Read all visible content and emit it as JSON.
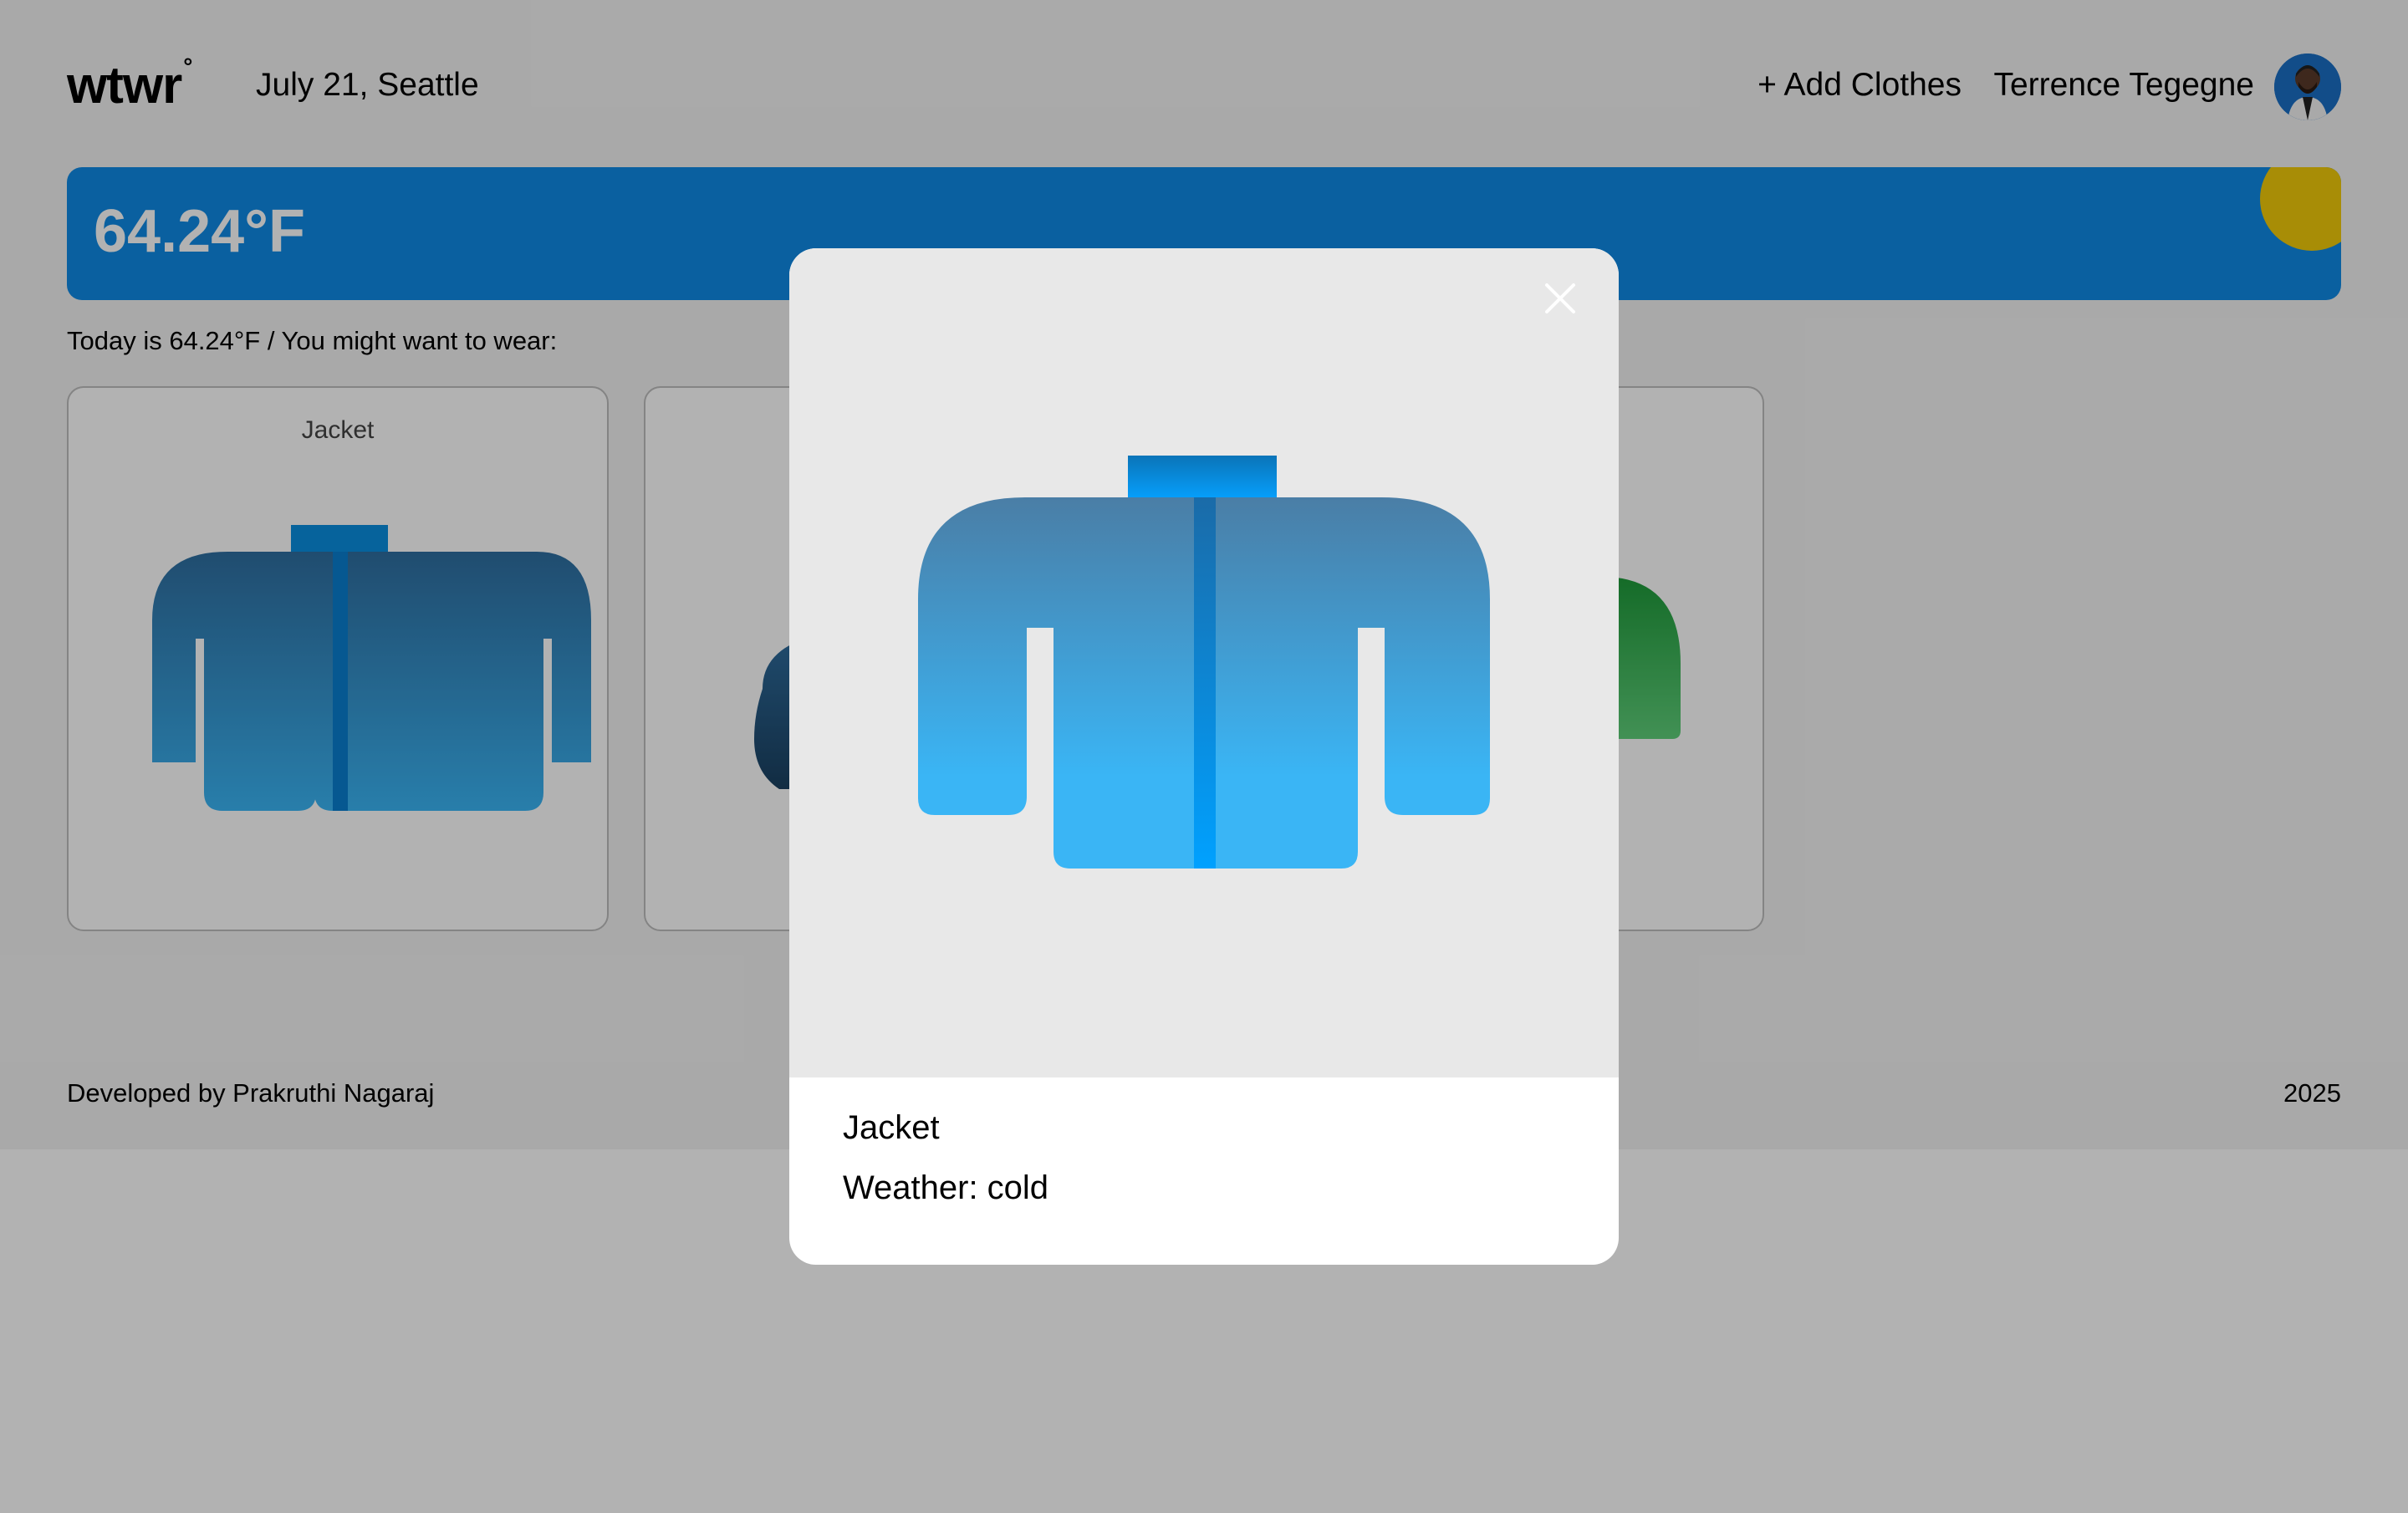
{
  "header": {
    "logo_text": "wtwr",
    "logo_degree": "°",
    "date_location": "July 21, Seattle",
    "add_clothes_label": "+ Add Clothes",
    "username": "Terrence Tegegne"
  },
  "weather": {
    "temperature": "64.24°F",
    "card_color": "#0f8ae6",
    "sun_color": "#f1cb09"
  },
  "main": {
    "today_text": "Today is 64.24°F / You might want to wear:",
    "cards": [
      {
        "name": "Jacket",
        "icon": "jacket-icon"
      },
      {
        "name": "",
        "icon": "cap-icon"
      },
      {
        "name": "",
        "icon": "jacket-icon"
      },
      {
        "name": "",
        "icon": "hoodie-icon"
      }
    ]
  },
  "footer": {
    "developer": "Developed by Prakruthi Nagaraj",
    "year": "2025"
  },
  "modal": {
    "item_name": "Jacket",
    "weather_label": "Weather: cold",
    "close_icon": "close-icon",
    "item_icon": "jacket-icon"
  }
}
